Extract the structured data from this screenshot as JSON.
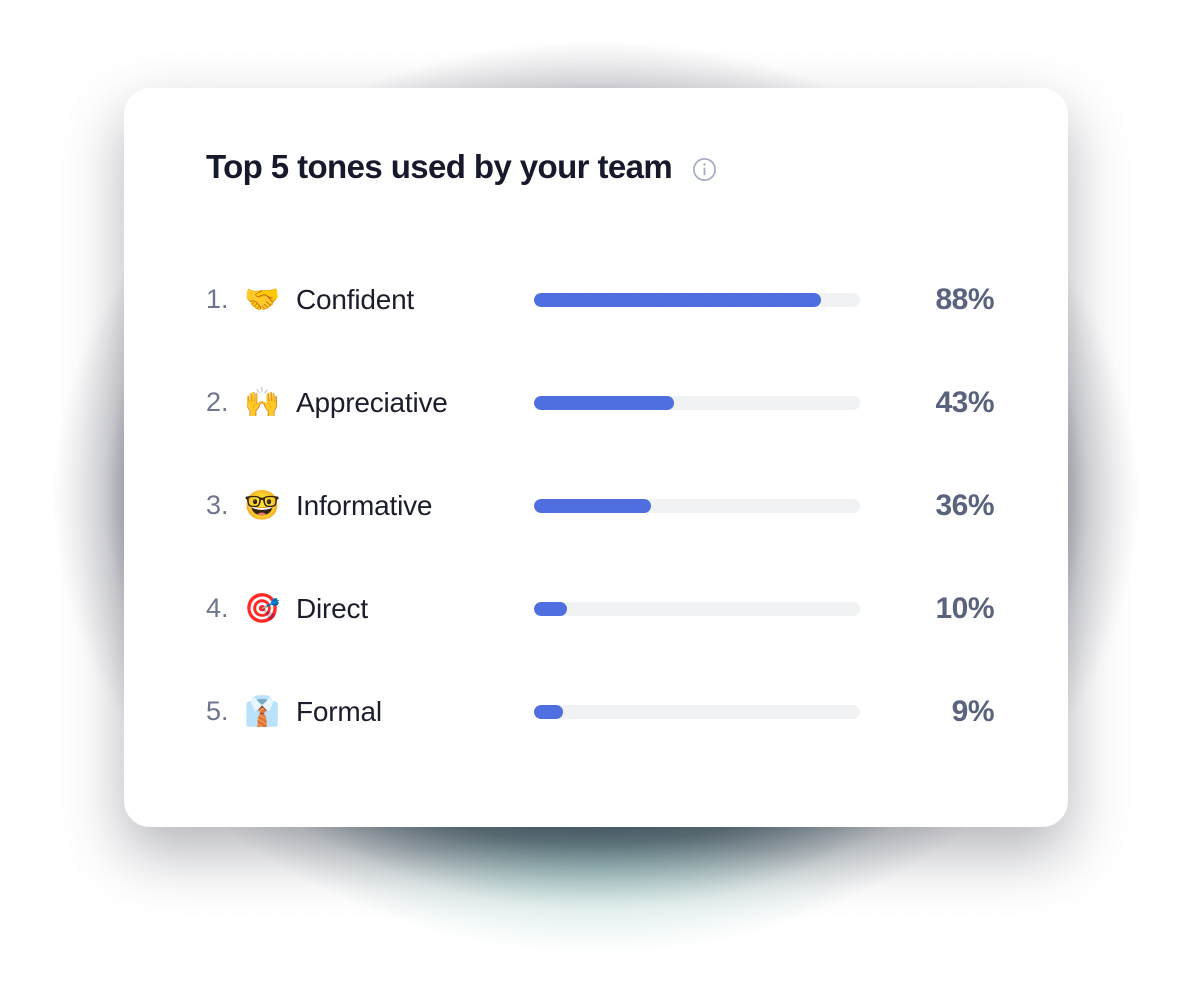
{
  "card": {
    "title": "Top 5 tones used by your team",
    "info_icon": "info-circle-icon"
  },
  "tones": [
    {
      "rank": "1.",
      "emoji": "🤝",
      "emoji_name": "handshake-emoji",
      "label": "Confident",
      "percent_label": "88%",
      "percent": 88
    },
    {
      "rank": "2.",
      "emoji": "🙌",
      "emoji_name": "raising-hands-emoji",
      "label": "Appreciative",
      "percent_label": "43%",
      "percent": 43
    },
    {
      "rank": "3.",
      "emoji": "🤓",
      "emoji_name": "nerd-face-emoji",
      "label": "Informative",
      "percent_label": "36%",
      "percent": 36
    },
    {
      "rank": "4.",
      "emoji": "🎯",
      "emoji_name": "bullseye-emoji",
      "label": "Direct",
      "percent_label": "10%",
      "percent": 10
    },
    {
      "rank": "5.",
      "emoji": "👔",
      "emoji_name": "necktie-emoji",
      "label": "Formal",
      "percent_label": "9%",
      "percent": 9
    }
  ],
  "chart_data": {
    "type": "bar",
    "title": "Top 5 tones used by your team",
    "xlabel": "",
    "ylabel": "",
    "categories": [
      "Confident",
      "Appreciative",
      "Informative",
      "Direct",
      "Formal"
    ],
    "values": [
      88,
      43,
      36,
      10,
      9
    ],
    "value_unit": "%",
    "xlim": [
      0,
      100
    ],
    "grid": false,
    "legend": "none",
    "orientation": "horizontal"
  },
  "colors": {
    "bar_fill": "#4f6fe0",
    "bar_track": "#f1f2f4",
    "percent_text": "#5a637e",
    "rank_text": "#6d768f",
    "label_text": "#1b1d2b",
    "title_text": "#16192b",
    "card_bg": "#ffffff",
    "backdrop_dark": "#22263c",
    "backdrop_teal": "#58a9a1",
    "info_icon": "#a3abc4"
  }
}
